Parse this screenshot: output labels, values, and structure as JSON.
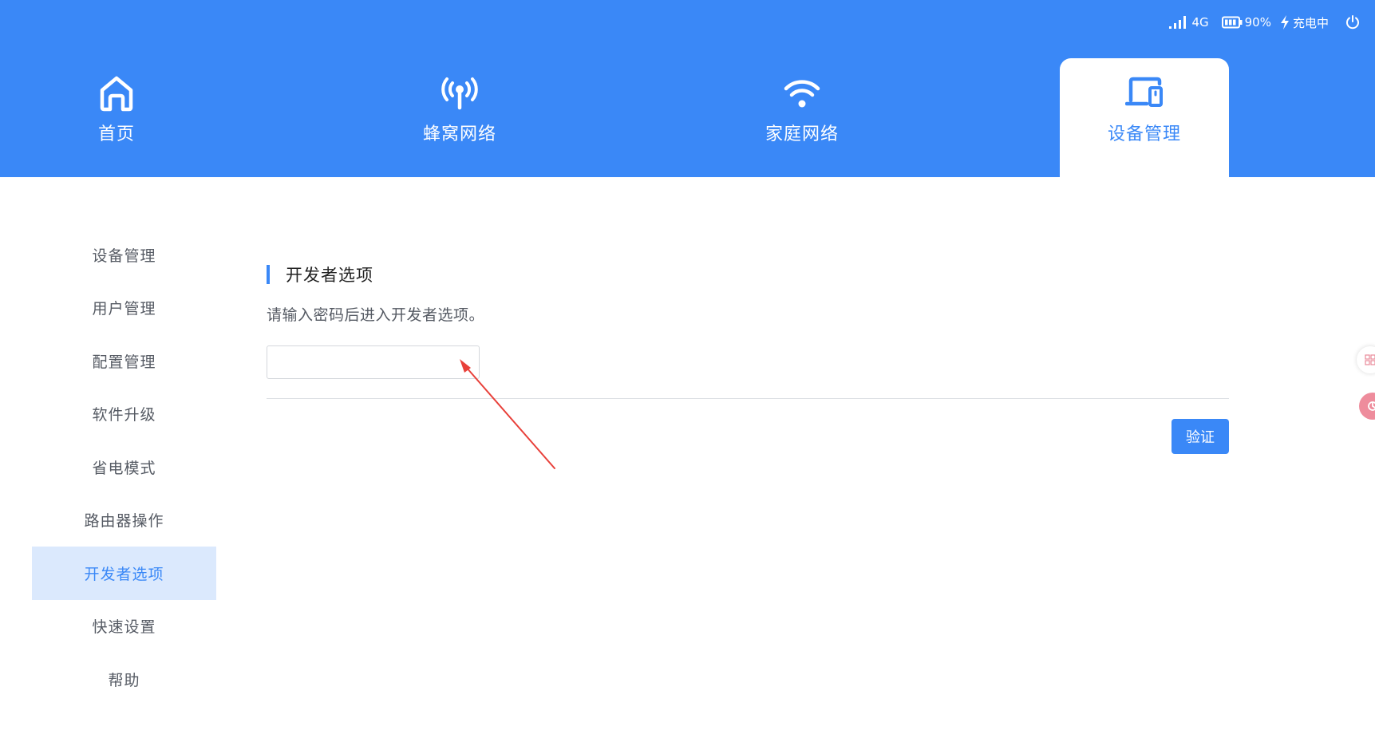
{
  "status": {
    "network": "4G",
    "battery": "90%",
    "charging": "充电中"
  },
  "nav": {
    "tabs": [
      {
        "label": "首页",
        "icon": "home-icon"
      },
      {
        "label": "蜂窝网络",
        "icon": "antenna-icon"
      },
      {
        "label": "家庭网络",
        "icon": "wifi-icon"
      },
      {
        "label": "设备管理",
        "icon": "devices-icon",
        "active": true
      }
    ]
  },
  "sidebar": {
    "items": [
      {
        "label": "设备管理"
      },
      {
        "label": "用户管理"
      },
      {
        "label": "配置管理"
      },
      {
        "label": "软件升级"
      },
      {
        "label": "省电模式"
      },
      {
        "label": "路由器操作"
      },
      {
        "label": "开发者选项",
        "active": true
      },
      {
        "label": "快速设置"
      },
      {
        "label": "帮助"
      }
    ]
  },
  "main": {
    "title": "开发者选项",
    "description": "请输入密码后进入开发者选项。",
    "password_value": "",
    "verify_label": "验证"
  },
  "colors": {
    "accent": "#3a88f7",
    "active_bg": "#dbe9fd",
    "annotation_arrow": "#e8403a"
  }
}
